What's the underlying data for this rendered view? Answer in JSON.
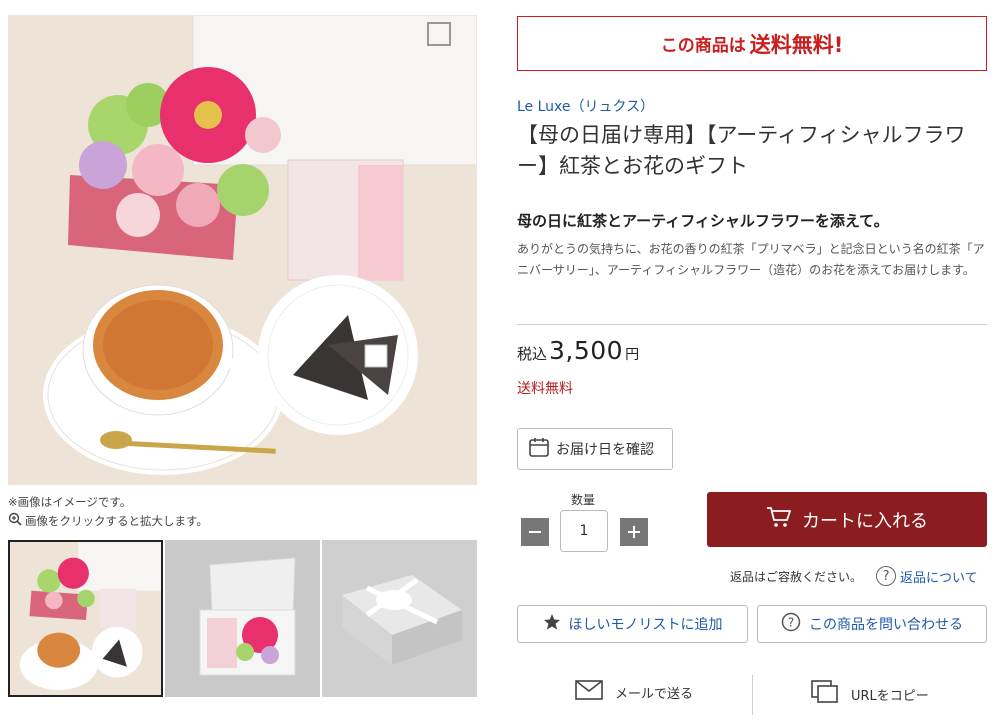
{
  "gallery": {
    "notes": [
      "※画像はイメージです。",
      "画像をクリックすると拡大します。"
    ]
  },
  "banner": {
    "prefix": "この商品は",
    "highlight": "送料無料!"
  },
  "product": {
    "brand": "Le Luxe（リュクス）",
    "title": "【母の日届け専用】【アーティフィシャルフラワー】紅茶とお花のギフト",
    "subheading": "母の日に紅茶とアーティフィシャルフラワーを添えて。",
    "description": "ありがとうの気持ちに、お花の香りの紅茶「プリマベラ」と記念日という名の紅茶「アニバーサリー」、アーティフィシャルフラワー（造花）のお花を添えてお届けします。",
    "tax_label": "税込",
    "price": "3,500",
    "yen": "円",
    "shipping": "送料無料"
  },
  "actions": {
    "delivery_date": "お届け日を確認",
    "quantity_label": "数量",
    "quantity_value": "1",
    "add_to_cart": "カートに入れる",
    "returns_note": "返品はご容赦ください。",
    "returns_link": "返品について",
    "wishlist": "ほしいモノリストに追加",
    "inquiry": "この商品を問い合わせる",
    "share_mail": "メールで送る",
    "share_url": "URLをコピー"
  },
  "colors": {
    "accent_red": "#c81e1e",
    "cart_button": "#8b1c1f",
    "link_blue": "#1f5aa8"
  }
}
